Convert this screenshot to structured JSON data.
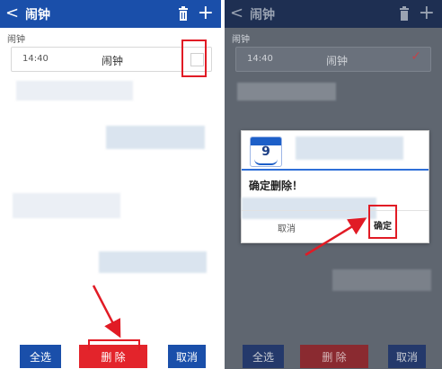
{
  "left_screen": {
    "appbar": {
      "back_glyph": "<",
      "title": "闹钟",
      "plus_glyph": "+"
    },
    "section_label": "闹钟",
    "alarm": {
      "time": "14:40",
      "name": "闹钟"
    },
    "buttons": {
      "select_all": "全选",
      "delete": "删 除",
      "cancel": "取消"
    }
  },
  "right_screen": {
    "appbar": {
      "back_glyph": "<",
      "title": "闹钟",
      "plus_glyph": "+"
    },
    "section_label": "闹钟",
    "alarm": {
      "time": "14:40",
      "name": "闹钟",
      "check_glyph": "✓"
    },
    "buttons": {
      "select_all": "全选",
      "delete": "删 除",
      "cancel": "取消"
    },
    "dialog": {
      "calendar_day": "9",
      "message": "确定删除！",
      "cancel": "取消",
      "confirm": "确定"
    }
  },
  "colors": {
    "appbar_blue": "#1a4faa",
    "delete_red": "#e3242b",
    "annotation_red": "#e11b25",
    "dialog_accent": "#2e6fd8"
  }
}
